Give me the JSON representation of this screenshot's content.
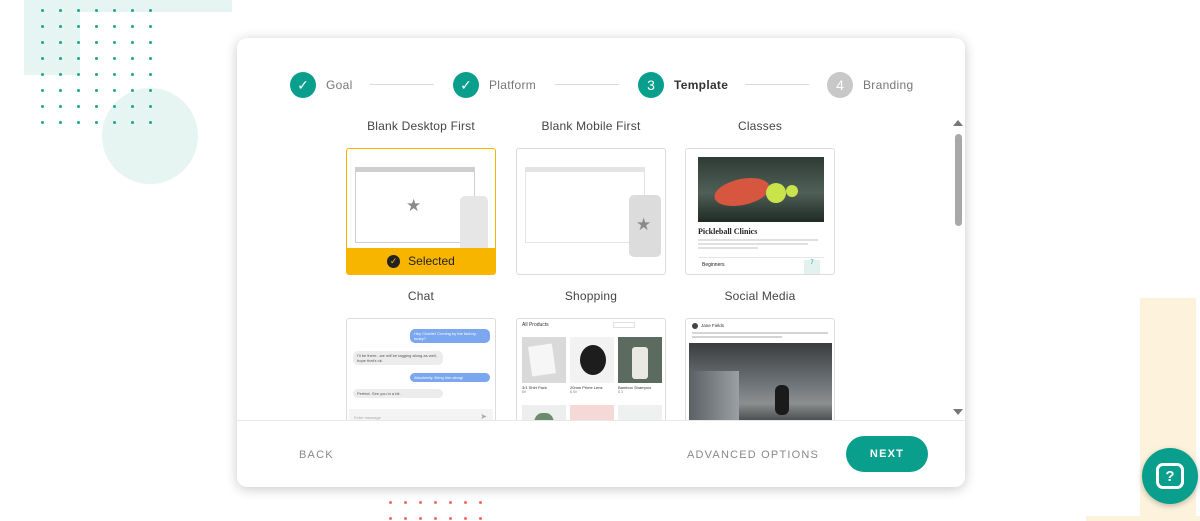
{
  "stepper": {
    "steps": [
      {
        "label": "Goal",
        "state": "done",
        "marker": "✓"
      },
      {
        "label": "Platform",
        "state": "done",
        "marker": "✓"
      },
      {
        "label": "Template",
        "state": "active",
        "marker": "3"
      },
      {
        "label": "Branding",
        "state": "todo",
        "marker": "4"
      }
    ]
  },
  "templates": [
    {
      "title": "Blank Desktop First",
      "selected_label": "Selected"
    },
    {
      "title": "Blank Mobile First"
    },
    {
      "title": "Classes",
      "heading": "Pickleball Clinics",
      "row_label": "Beginners",
      "badge_number": "7"
    },
    {
      "title": "Chat",
      "messages": [
        {
          "from": "me",
          "text": "Hey Charlie! Coming by the factory today?"
        },
        {
          "from": "them",
          "text": "I'll be there...we will be tagging along as well, hope that's ok."
        },
        {
          "from": "me",
          "text": "Absolutely. Bring him along!"
        },
        {
          "from": "them",
          "text": "Perfect. See you in a bit."
        }
      ],
      "input_placeholder": "Enter message"
    },
    {
      "title": "Shopping",
      "header": "All Products",
      "products": [
        {
          "name": "3/1 Shirt Pack",
          "price": "$9"
        },
        {
          "name": "20mm Prime Lens",
          "price": "$ 50"
        },
        {
          "name": "Bamboo Shampoo",
          "price": "$ 3"
        }
      ]
    },
    {
      "title": "Social Media",
      "author": "Jane Fields"
    }
  ],
  "footer": {
    "back_label": "BACK",
    "advanced_label": "ADVANCED OPTIONS",
    "next_label": "NEXT"
  },
  "colors": {
    "accent": "#0a9e8c",
    "selected": "#f7b500",
    "inactive_step": "#c8c8c8"
  },
  "icons": {
    "step_done": "check-icon",
    "placeholder": "star-icon",
    "help": "help-chat-icon"
  }
}
